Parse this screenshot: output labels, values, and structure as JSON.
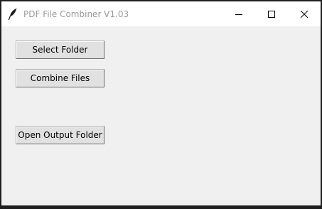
{
  "window": {
    "title": "PDF File Combiner V1.03",
    "app_icon": "feather-icon",
    "controls": {
      "minimize_icon": "minimize-icon",
      "maximize_icon": "maximize-icon",
      "close_icon": "close-icon"
    }
  },
  "buttons": {
    "select_folder": "Select Folder",
    "combine_files": "Combine Files",
    "open_output_folder": "Open Output Folder"
  }
}
